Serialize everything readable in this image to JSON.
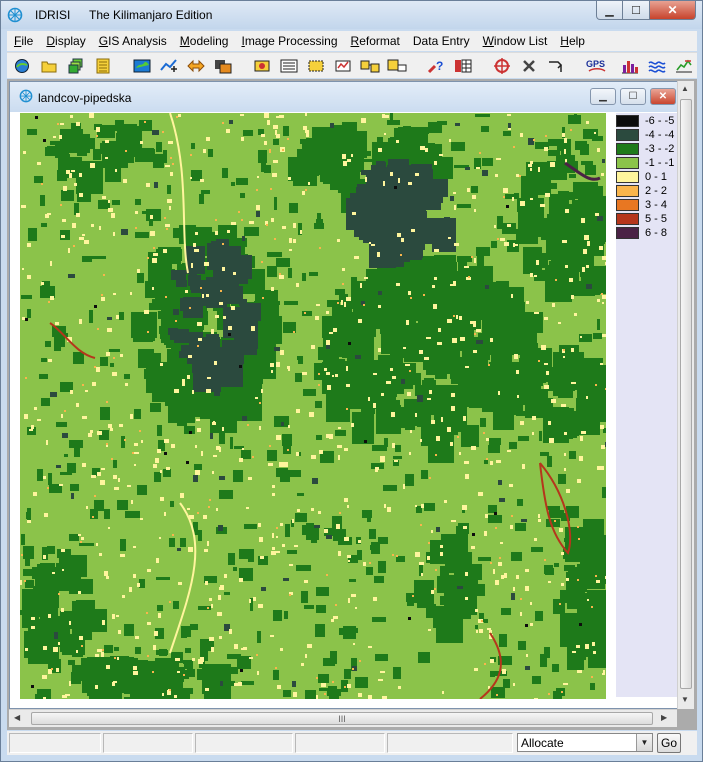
{
  "app": {
    "title": "IDRISI",
    "edition": "The Kilimanjaro Edition"
  },
  "window_controls": {
    "minimize": "▁",
    "maximize": "☐",
    "close": "✕"
  },
  "menu": [
    {
      "label": "File",
      "accel": "F",
      "rest": "ile"
    },
    {
      "label": "Display",
      "accel": "D",
      "rest": "isplay"
    },
    {
      "label": "GIS Analysis",
      "accel": "G",
      "rest": "IS Analysis"
    },
    {
      "label": "Modeling",
      "accel": "M",
      "rest": "odeling"
    },
    {
      "label": "Image Processing",
      "accel": "I",
      "rest": "mage Processing"
    },
    {
      "label": "Reformat",
      "accel": "R",
      "rest": "eformat"
    },
    {
      "label": "Data Entry",
      "accel": "",
      "rest": "Data Entry"
    },
    {
      "label": "Window List",
      "accel": "W",
      "rest": "indow List"
    },
    {
      "label": "Help",
      "accel": "H",
      "rest": "elp"
    }
  ],
  "toolbar": {
    "icons": [
      "display-launcher-icon",
      "open-folder-icon",
      "composer-icon",
      "properties-icon",
      "map-window-icon",
      "add-layer-icon",
      "pan-icon",
      "zoom-window-icon",
      "digitize-icon",
      "feature-properties-icon",
      "select-icon",
      "measure-icon",
      "placemark-icon",
      "layer-edit-icon",
      "query-icon",
      "table-icon",
      "target-icon",
      "tools-icon",
      "redraw-icon"
    ],
    "gps_label": "GPS",
    "tail_icons": [
      "histogram-icon",
      "surface-icon",
      "profile-icon"
    ]
  },
  "child_window": {
    "title": "landcov-pipedska",
    "controls": {
      "minimize": "▁",
      "maximize": "☐",
      "close": "✕"
    }
  },
  "legend": {
    "entries": [
      {
        "label": "-6 - -5",
        "color": "#0d0d0d"
      },
      {
        "label": "-4 - -4",
        "color": "#2b4a3e"
      },
      {
        "label": "-3 - -2",
        "color": "#1e7a1a"
      },
      {
        "label": "-1 - -1",
        "color": "#8bc34a"
      },
      {
        "label": "0 - 1",
        "color": "#fff59d"
      },
      {
        "label": "2 - 2",
        "color": "#f9b54c"
      },
      {
        "label": "3 - 4",
        "color": "#e87722"
      },
      {
        "label": "5 - 5",
        "color": "#b5361c"
      },
      {
        "label": "6 - 8",
        "color": "#4a2245"
      }
    ]
  },
  "scrollbar": {
    "grip": "III"
  },
  "status": {
    "dropdown_value": "Allocate",
    "go_label": "Go"
  }
}
